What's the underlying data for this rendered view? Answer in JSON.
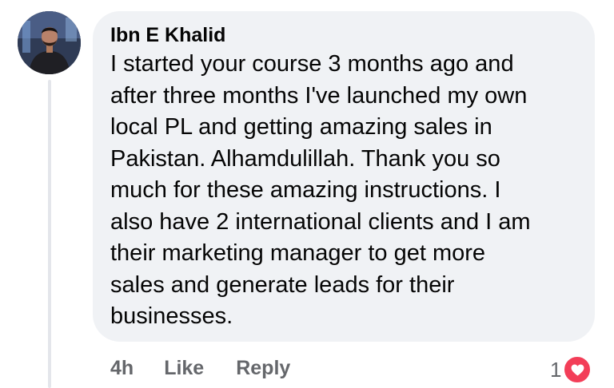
{
  "comment": {
    "author": "Ibn E Khalid",
    "text": "I started your course 3 months ago and\nafter three months I've launched my own\nlocal PL and getting amazing sales in\nPakistan. Alhamdulillah. Thank you so\nmuch for these amazing instructions. I\nalso have 2 international clients and I am\ntheir marketing manager to get more\nsales and generate leads for their\nbusinesses.",
    "timestamp": "4h",
    "like_label": "Like",
    "reply_label": "Reply",
    "reaction_count": "1",
    "reaction_icon": "heart-icon",
    "colors": {
      "bubble": "#f0f2f5",
      "meta_text": "#65676b",
      "reaction": "#f33e58"
    }
  }
}
